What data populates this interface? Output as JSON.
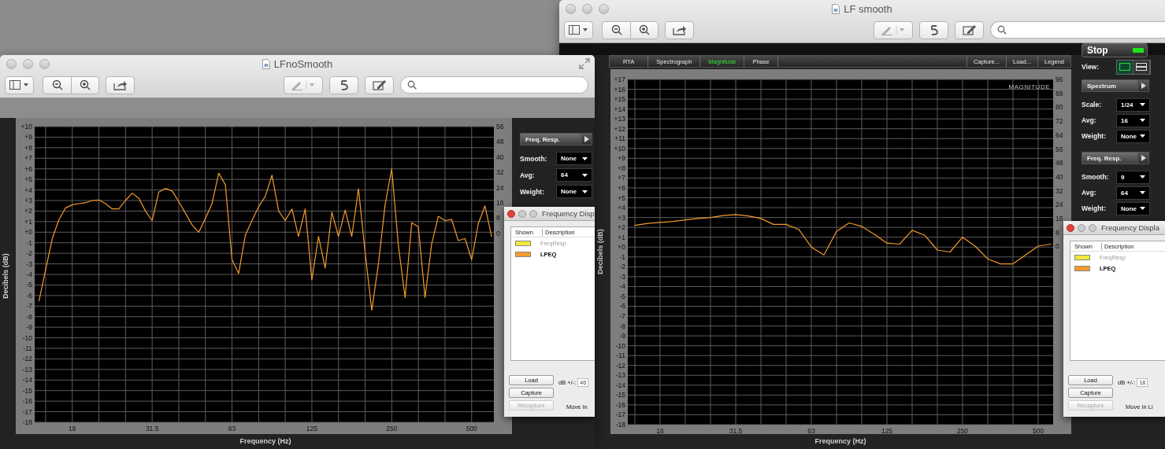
{
  "windows": [
    {
      "title": "LFnoSmooth",
      "analyzer": {
        "chart_data": {
          "type": "line",
          "xlabel": "Frequency (Hz)",
          "ylabel": "Decibels (dB)",
          "categories": [
            null,
            null,
            null,
            null,
            null,
            "16",
            null,
            null,
            null,
            null,
            null,
            null,
            null,
            null,
            null,
            null,
            null,
            "31.5",
            null,
            null,
            null,
            null,
            null,
            null,
            null,
            null,
            null,
            null,
            null,
            "63",
            null,
            null,
            null,
            null,
            null,
            null,
            null,
            null,
            null,
            null,
            null,
            "125",
            null,
            null,
            null,
            null,
            null,
            null,
            null,
            null,
            null,
            null,
            null,
            "250",
            null,
            null,
            null,
            null,
            null,
            null,
            null,
            null,
            null,
            null,
            null,
            "500",
            null,
            null,
            null
          ],
          "series": [
            {
              "color": "#f39a2c",
              "values": [
                -6.5,
                -3.5,
                -0.6,
                1.2,
                2.3,
                2.6,
                2.7,
                2.8,
                3.0,
                3.05,
                2.7,
                2.2,
                2.2,
                3.0,
                3.7,
                3.2,
                2.0,
                1.1,
                3.8,
                4.15,
                3.9,
                2.9,
                1.8,
                0.7,
                0.0,
                1.3,
                2.7,
                5.6,
                4.5,
                -2.6,
                -3.9,
                -0.3,
                1.1,
                2.4,
                3.4,
                5.4,
                2.0,
                1.1,
                2.2,
                -0.4,
                2.2,
                -4.5,
                -0.4,
                -3.4,
                1.9,
                -0.4,
                2.1,
                -0.4,
                4.1,
                -1.9,
                -7.4,
                -3.0,
                2.6,
                6.0,
                -1.3,
                -6.2,
                0.9,
                0.5,
                -6.2,
                -1.1,
                1.5,
                1.1,
                1.2,
                -0.8,
                -0.6,
                -2.6,
                0.8,
                2.5,
                -0.4
              ]
            }
          ],
          "ylim": [
            -18,
            10
          ],
          "grid": true,
          "yticks": [
            {
              "value": 10,
              "label": "+10"
            },
            {
              "value": 9,
              "label": "+9"
            },
            {
              "value": 8,
              "label": "+8"
            },
            {
              "value": 7,
              "label": "+7"
            },
            {
              "value": 6,
              "label": "+6"
            },
            {
              "value": 5,
              "label": "+5"
            },
            {
              "value": 4,
              "label": "+4"
            },
            {
              "value": 3,
              "label": "+3"
            },
            {
              "value": 2,
              "label": "+2"
            },
            {
              "value": 1,
              "label": "+1"
            },
            {
              "value": 0,
              "label": "+0"
            },
            {
              "value": -1,
              "label": "-1"
            },
            {
              "value": -2,
              "label": "-2"
            },
            {
              "value": -3,
              "label": "-3"
            },
            {
              "value": -4,
              "label": "-4"
            },
            {
              "value": -5,
              "label": "-5"
            },
            {
              "value": -6,
              "label": "-6"
            },
            {
              "value": -7,
              "label": "-7"
            },
            {
              "value": -8,
              "label": "-8"
            },
            {
              "value": -9,
              "label": "-9"
            },
            {
              "value": -10,
              "label": "-10"
            },
            {
              "value": -11,
              "label": "-11"
            },
            {
              "value": -12,
              "label": "-12"
            },
            {
              "value": -13,
              "label": "-13"
            },
            {
              "value": -14,
              "label": "-14"
            },
            {
              "value": -15,
              "label": "-15"
            },
            {
              "value": -16,
              "label": "-16"
            },
            {
              "value": -17,
              "label": "-17"
            },
            {
              "value": -18,
              "label": "-18"
            }
          ]
        },
        "right_axis_labels": [
          "56",
          "48",
          "40",
          "32",
          "24",
          "16",
          "8",
          "0"
        ],
        "panel": {
          "sections": [
            {
              "header": "Freq. Resp.",
              "rows": [
                {
                  "label": "Smooth:",
                  "value": "None"
                },
                {
                  "label": "Avg:",
                  "value": "64"
                },
                {
                  "label": "Weight:",
                  "value": "None"
                }
              ]
            }
          ]
        },
        "dialog": {
          "title": "Frequency Disp",
          "columns": [
            "Shown",
            "Description"
          ],
          "rows": [
            {
              "label": "FreqResp",
              "color": "#f2e83a",
              "shown": false
            },
            {
              "label": "LPEQ",
              "color": "#f39a2c",
              "shown": true
            }
          ],
          "buttons": [
            {
              "label": "Load",
              "disabled": false
            },
            {
              "label": "Capture",
              "disabled": false
            },
            {
              "label": "Recapture",
              "disabled": true
            }
          ],
          "db_label": "dB +/-:",
          "db_value": "46",
          "move_label": "Move In"
        }
      }
    },
    {
      "title": "LF smooth",
      "analyzer": {
        "tabs": [
          {
            "label": "RTA",
            "selected": false
          },
          {
            "label": "Spectrograph",
            "selected": false
          },
          {
            "label": "Magnitude",
            "selected": true
          },
          {
            "label": "Phase",
            "selected": false
          }
        ],
        "actions": [
          "Capture...",
          "Load...",
          "Legend"
        ],
        "chart_data": {
          "type": "line",
          "title": "MAGNITUDE",
          "xlabel": "Frequency (Hz)",
          "ylabel": "Decibels (dB)",
          "categories": [
            null,
            null,
            "16",
            null,
            null,
            null,
            null,
            null,
            "31.5",
            null,
            null,
            null,
            null,
            null,
            "63",
            null,
            null,
            null,
            null,
            null,
            "125",
            null,
            null,
            null,
            null,
            null,
            "250",
            null,
            null,
            null,
            null,
            null,
            "500",
            null
          ],
          "series": [
            {
              "color": "#f39a2c",
              "values": [
                2.2,
                2.4,
                2.5,
                2.6,
                2.75,
                2.9,
                3.0,
                3.2,
                3.3,
                3.15,
                2.9,
                2.3,
                2.3,
                1.8,
                0.0,
                -0.8,
                1.6,
                2.45,
                2.1,
                1.3,
                0.4,
                0.3,
                1.7,
                1.2,
                -0.3,
                -0.5,
                1.0,
                0.1,
                -1.2,
                -1.7,
                -1.7,
                -0.8,
                0.1,
                0.3
              ]
            }
          ],
          "ylim": [
            -18,
            17
          ],
          "grid": true,
          "yticks": [
            {
              "value": 17,
              "label": "+17"
            },
            {
              "value": 16,
              "label": "+16"
            },
            {
              "value": 15,
              "label": "+15"
            },
            {
              "value": 14,
              "label": "+14"
            },
            {
              "value": 13,
              "label": "+13"
            },
            {
              "value": 12,
              "label": "+12"
            },
            {
              "value": 11,
              "label": "+11"
            },
            {
              "value": 10,
              "label": "+10"
            },
            {
              "value": 9,
              "label": "+9"
            },
            {
              "value": 8,
              "label": "+8"
            },
            {
              "value": 7,
              "label": "+7"
            },
            {
              "value": 6,
              "label": "+6"
            },
            {
              "value": 5,
              "label": "+5"
            },
            {
              "value": 4,
              "label": "+4"
            },
            {
              "value": 3,
              "label": "+3"
            },
            {
              "value": 2,
              "label": "+2"
            },
            {
              "value": 1,
              "label": "+1"
            },
            {
              "value": 0,
              "label": "+0"
            },
            {
              "value": -1,
              "label": "-1"
            },
            {
              "value": -2,
              "label": "-2"
            },
            {
              "value": -3,
              "label": "-3"
            },
            {
              "value": -4,
              "label": "-4"
            },
            {
              "value": -5,
              "label": "-5"
            },
            {
              "value": -6,
              "label": "-6"
            },
            {
              "value": -7,
              "label": "-7"
            },
            {
              "value": -8,
              "label": "-8"
            },
            {
              "value": -9,
              "label": "-9"
            },
            {
              "value": -10,
              "label": "-10"
            },
            {
              "value": -11,
              "label": "-11"
            },
            {
              "value": -12,
              "label": "-12"
            },
            {
              "value": -13,
              "label": "-13"
            },
            {
              "value": -14,
              "label": "-14"
            },
            {
              "value": -15,
              "label": "-15"
            },
            {
              "value": -16,
              "label": "-16"
            },
            {
              "value": -17,
              "label": "-17"
            },
            {
              "value": -18,
              "label": "-18"
            }
          ]
        },
        "right_axis_labels": [
          "96",
          "88",
          "80",
          "72",
          "64",
          "56",
          "48",
          "40",
          "32",
          "24",
          "16",
          "8",
          "0"
        ],
        "panel": {
          "stop_button": {
            "label": "Stop",
            "running": true
          },
          "view": {
            "label": "View:",
            "options": [
              {
                "kind": "single",
                "selected": true
              },
              {
                "kind": "split",
                "selected": false
              }
            ]
          },
          "sections": [
            {
              "header": "Spectrum",
              "rows": [
                {
                  "label": "Scale:",
                  "value": "1/24"
                },
                {
                  "label": "Avg:",
                  "value": "16"
                },
                {
                  "label": "Weight:",
                  "value": "None"
                }
              ]
            },
            {
              "header": "Freq. Resp.",
              "rows": [
                {
                  "label": "Smooth:",
                  "value": "9"
                },
                {
                  "label": "Avg:",
                  "value": "64"
                },
                {
                  "label": "Weight:",
                  "value": "None"
                }
              ]
            }
          ]
        },
        "dialog": {
          "title": "Frequency Displa",
          "columns": [
            "Shown",
            "Description"
          ],
          "rows": [
            {
              "label": "FreqResp",
              "color": "#f2e83a",
              "shown": false
            },
            {
              "label": "LPEQ",
              "color": "#f39a2c",
              "shown": true
            }
          ],
          "buttons": [
            {
              "label": "Load",
              "disabled": false
            },
            {
              "label": "Capture",
              "disabled": false
            },
            {
              "label": "Recapture",
              "disabled": true
            }
          ],
          "db_label": "dB +/-:",
          "db_value": "18",
          "move_label": "Move In Li"
        }
      }
    }
  ]
}
